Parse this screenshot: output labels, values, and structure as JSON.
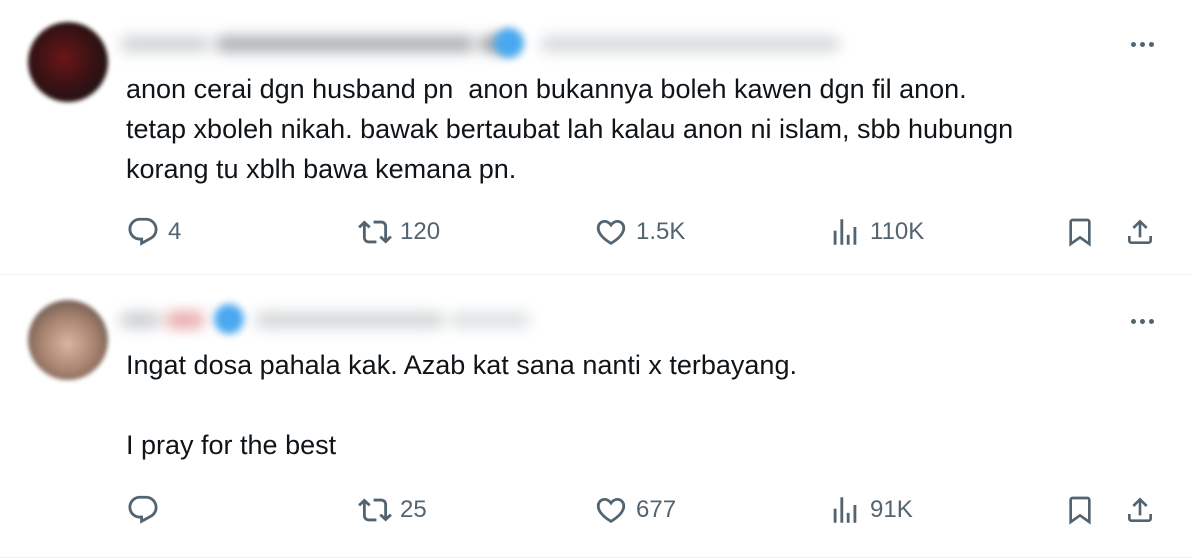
{
  "tweets": [
    {
      "text": "anon cerai dgn husband pn  anon bukannya boleh kawen dgn fil anon.\ntetap xboleh nikah. bawak bertaubat lah kalau anon ni islam, sbb hubungn\nkorang tu xblh bawa kemana pn.",
      "replies": "4",
      "reposts": "120",
      "likes": "1.5K",
      "views": "110K"
    },
    {
      "text": "Ingat dosa pahala kak. Azab kat sana nanti x terbayang.\n\nI pray for the best",
      "replies": "",
      "reposts": "25",
      "likes": "677",
      "views": "91K"
    }
  ],
  "colors": {
    "text": "#0f1419",
    "muted": "#536471",
    "divider": "#eff3f4",
    "verified": "#1d9bf0"
  },
  "icons": {
    "more": "more-horizontal-icon",
    "reply": "reply-icon",
    "repost": "repost-icon",
    "like": "heart-icon",
    "views": "views-icon",
    "bookmark": "bookmark-icon",
    "share": "share-icon"
  }
}
